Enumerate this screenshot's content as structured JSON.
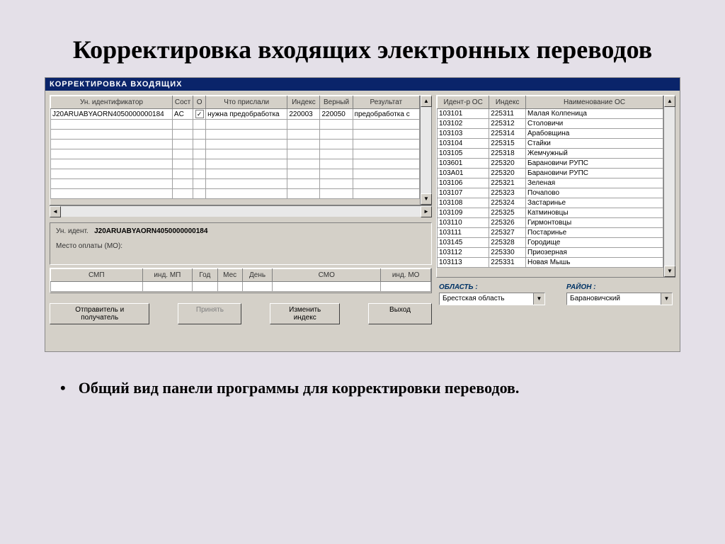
{
  "slide": {
    "title": "Корректировка входящих электронных переводов",
    "bullet": "Общий вид панели программы для корректировки переводов."
  },
  "window": {
    "title": "КОРРЕКТИРОВКА  ВХОДЯЩИХ"
  },
  "left_grid": {
    "headers": [
      "Ун. идентификатор",
      "Сост",
      "О",
      "Что прислали",
      "Индекс",
      "Верный",
      "Результат"
    ],
    "row": {
      "id": "J20ARUABYAORN4050000000184",
      "state": "AC",
      "o_checked": "✓",
      "sent": "нужна предобработка",
      "index": "220003",
      "correct": "220050",
      "result": "предобработка с"
    }
  },
  "detail": {
    "id_label": "Ун. идент.",
    "id_value": "J20ARUABYAORN4050000000184",
    "place_label": "Место оплаты (МО):"
  },
  "sub_headers": [
    "СМП",
    "инд. МП",
    "Год",
    "Мес",
    "День",
    "СМО",
    "инд. МО"
  ],
  "buttons": {
    "sender": "Отправитель и получатель",
    "accept": "Принять",
    "change": "Изменить индекс",
    "exit": "Выход"
  },
  "right_grid": {
    "headers": [
      "Идент-р ОС",
      "Индекс",
      "Наименование ОС"
    ],
    "rows": [
      {
        "id": "103101",
        "idx": "225311",
        "name": "Малая Колпеница"
      },
      {
        "id": "103102",
        "idx": "225312",
        "name": "Столовичи"
      },
      {
        "id": "103103",
        "idx": "225314",
        "name": "Арабовщина"
      },
      {
        "id": "103104",
        "idx": "225315",
        "name": "Стайки"
      },
      {
        "id": "103105",
        "idx": "225318",
        "name": "Жемчужный"
      },
      {
        "id": "103601",
        "idx": "225320",
        "name": "Барановичи РУПС"
      },
      {
        "id": "103А01",
        "idx": "225320",
        "name": "Барановичи РУПС"
      },
      {
        "id": "103106",
        "idx": "225321",
        "name": "Зеленая"
      },
      {
        "id": "103107",
        "idx": "225323",
        "name": "Почапово"
      },
      {
        "id": "103108",
        "idx": "225324",
        "name": "Застаринье"
      },
      {
        "id": "103109",
        "idx": "225325",
        "name": "Катминовцы"
      },
      {
        "id": "103110",
        "idx": "225326",
        "name": "Гирмонтовцы"
      },
      {
        "id": "103111",
        "idx": "225327",
        "name": "Постаринье"
      },
      {
        "id": "103145",
        "idx": "225328",
        "name": "Городище"
      },
      {
        "id": "103112",
        "idx": "225330",
        "name": "Приозерная"
      },
      {
        "id": "103113",
        "idx": "225331",
        "name": "Новая Мышь"
      }
    ]
  },
  "combos": {
    "region_label": "ОБЛАСТЬ :",
    "region_value": "Брестская область",
    "district_label": "РАЙОН :",
    "district_value": "Барановичский"
  }
}
